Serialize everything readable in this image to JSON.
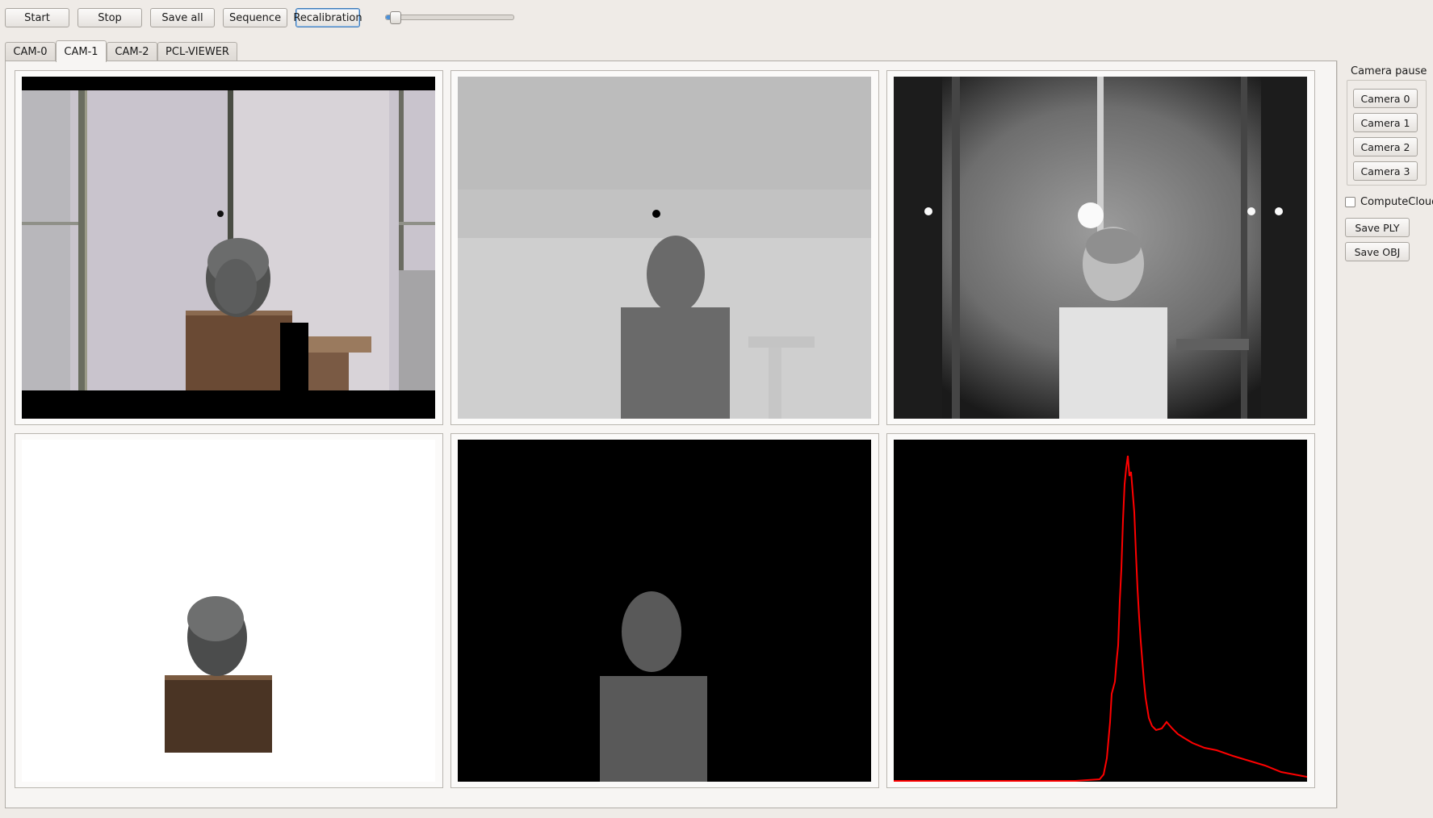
{
  "toolbar": {
    "start_label": "Start",
    "stop_label": "Stop",
    "save_all_label": "Save all",
    "sequence_label": "Sequence",
    "recalibration_label": "Recalibration",
    "slider_value_percent": 6
  },
  "tabs": [
    {
      "label": "CAM-0",
      "active": false
    },
    {
      "label": "CAM-1",
      "active": true
    },
    {
      "label": "CAM-2",
      "active": false
    },
    {
      "label": "PCL-VIEWER",
      "active": false
    }
  ],
  "side_panel": {
    "camera_pause_title": "Camera pause",
    "camera_buttons": [
      "Camera 0",
      "Camera 1",
      "Camera 2",
      "Camera 3"
    ],
    "compute_cloud_label": "ComputeCloud",
    "compute_cloud_checked": false,
    "save_ply_label": "Save PLY",
    "save_obj_label": "Save OBJ"
  },
  "views": {
    "top_left": "color-image",
    "top_middle": "depth-image",
    "top_right": "infrared-image",
    "bottom_left": "segmented-color-image",
    "bottom_middle": "segmented-depth-image",
    "bottom_right": "depth-histogram"
  },
  "colors": {
    "histogram_line": "#ff0000",
    "focus_border": "#3d7ab8",
    "slider_fill": "#4a90d9"
  }
}
